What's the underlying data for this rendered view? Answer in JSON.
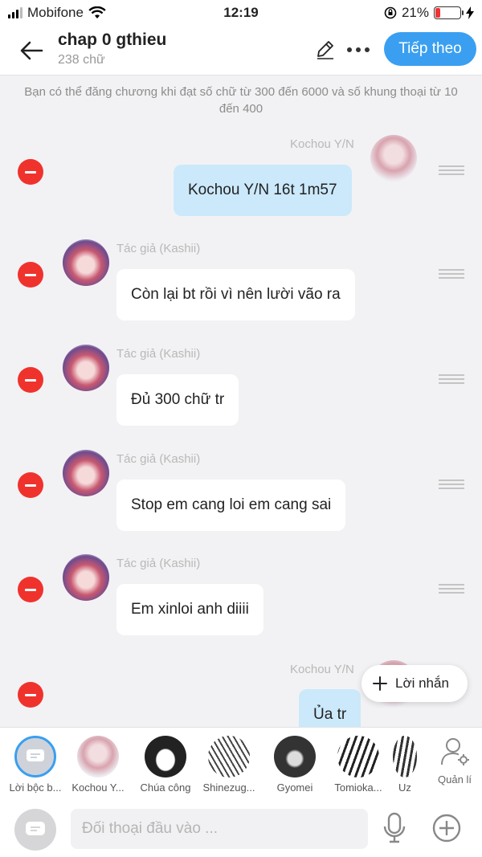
{
  "status_bar": {
    "carrier": "Mobifone",
    "time": "12:19",
    "battery_percent": "21%",
    "battery_level": 0.21,
    "icons": [
      "signal-icon",
      "wifi-icon",
      "orientation-lock-icon",
      "battery-icon",
      "charging-icon"
    ]
  },
  "header": {
    "title": "chap 0 gthieu",
    "word_count": "238 chữ",
    "next_label": "Tiếp theo",
    "accent_color": "#3a9ff0"
  },
  "note": "Bạn có thể đăng chương khi đạt số chữ từ 300 đến 6000 và số khung thoại từ 10 đến 400",
  "messages": [
    {
      "side": "right",
      "sender": "Kochou Y/N",
      "text": "Kochou Y/N 16t 1m57"
    },
    {
      "side": "left",
      "sender": "Tác giả (Kashii)",
      "text": "Còn lại bt rồi vì nên lười vão ra"
    },
    {
      "side": "left",
      "sender": "Tác giả (Kashii)",
      "text": "Đủ 300 chữ tr"
    },
    {
      "side": "left",
      "sender": "Tác giả (Kashii)",
      "text": "Stop em cang loi em cang sai"
    },
    {
      "side": "left",
      "sender": "Tác giả (Kashii)",
      "text": "Em xinloi anh diiii"
    },
    {
      "side": "right",
      "sender": "Kochou Y/N",
      "text": "Ủa tr"
    }
  ],
  "add_message_label": "Lời nhắn",
  "characters": [
    {
      "name": "Lời bộc b...",
      "selected": true
    },
    {
      "name": "Kochou Y..."
    },
    {
      "name": "Chúa công"
    },
    {
      "name": "Shinezug..."
    },
    {
      "name": "Gyomei"
    },
    {
      "name": "Tomioka..."
    },
    {
      "name": "Uz"
    }
  ],
  "manage_label": "Quản lí",
  "input": {
    "placeholder": "Đối thoại đầu vào ..."
  }
}
